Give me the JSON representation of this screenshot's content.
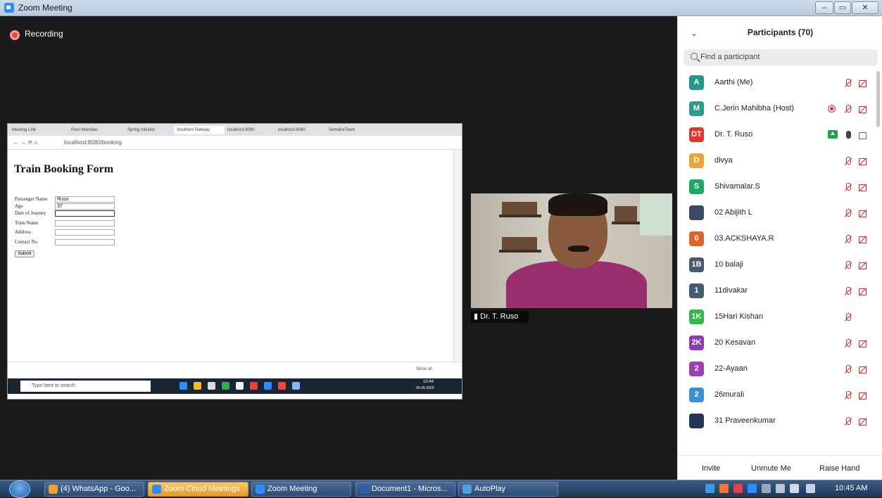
{
  "window": {
    "title": "Zoom Meeting",
    "min_label": "‒",
    "max_label": "▭",
    "close_label": "✕"
  },
  "meeting": {
    "recording_label": "Recording",
    "video_name": "Dr. T. Ruso",
    "shared_screen": {
      "tabs": [
        "Meeting Link",
        "Post Attendee",
        "Spring Initializr",
        "Southern Railway",
        "localhost:8080",
        "localhost:8080",
        "SemaforTeam"
      ],
      "url": "localhost:8080/booking",
      "form_title": "Train Booking Form",
      "fields": [
        {
          "label": "Passenger Name",
          "value": "Ruso"
        },
        {
          "label": "Age",
          "value": "37"
        },
        {
          "label": "Date of Journey",
          "value": ""
        },
        {
          "label": "Train Name",
          "value": ""
        },
        {
          "label": "Address",
          "value": ""
        },
        {
          "label": "Contact No",
          "value": ""
        }
      ],
      "submit_label": "Submit",
      "show_all": "Show all",
      "taskbar_search": "Type here to search",
      "taskbar_time": "10:44",
      "taskbar_date": "06-06-2020"
    }
  },
  "participants": {
    "title": "Participants (70)",
    "search_placeholder": "Find a participant",
    "list": [
      {
        "initials": "A",
        "name": "Aarthi (Me)",
        "color": "#22998a"
      },
      {
        "initials": "M",
        "name": "C.Jerin Mahibha (Host)",
        "color": "#2a9d8f"
      },
      {
        "initials": "DT",
        "name": "Dr. T. Ruso",
        "color": "#e0382e"
      },
      {
        "initials": "D",
        "name": "divya",
        "color": "#f0a23a"
      },
      {
        "initials": "S",
        "name": "Shivamalar.S",
        "color": "#1fa866"
      },
      {
        "initials": "",
        "name": "02 Abijith L",
        "color": "#3a4a66"
      },
      {
        "initials": "0",
        "name": "03.ACKSHAYA.R",
        "color": "#e0632c"
      },
      {
        "initials": "1B",
        "name": "10 balaji",
        "color": "#455a70"
      },
      {
        "initials": "1",
        "name": "11divakar",
        "color": "#455a70"
      },
      {
        "initials": "1K",
        "name": "15Hari Kishan",
        "color": "#33b84e"
      },
      {
        "initials": "2K",
        "name": "20 Kesavan",
        "color": "#8a3fb0"
      },
      {
        "initials": "2",
        "name": "22-Ayaan",
        "color": "#9b40b5"
      },
      {
        "initials": "2",
        "name": "26murali",
        "color": "#3a8fd0"
      },
      {
        "initials": "",
        "name": "31 Praveenkumar",
        "color": "#263552"
      }
    ],
    "footer": {
      "invite": "Invite",
      "unmute": "Unmute Me",
      "raise_hand": "Raise Hand"
    }
  },
  "taskbar": {
    "items": [
      {
        "label": "(4) WhatsApp - Goo...",
        "active": false,
        "icon_color": "#f0a030"
      },
      {
        "label": "Zoom Cloud Meetings",
        "active": true,
        "icon_color": "#2d8cff"
      },
      {
        "label": "Zoom Meeting",
        "active": false,
        "icon_color": "#2d8cff"
      },
      {
        "label": "Document1 - Micros...",
        "active": false,
        "icon_color": "#2b5ea8"
      },
      {
        "label": "AutoPlay",
        "active": false,
        "icon_color": "#4fa0e0"
      }
    ],
    "clock": "10:45 AM"
  }
}
